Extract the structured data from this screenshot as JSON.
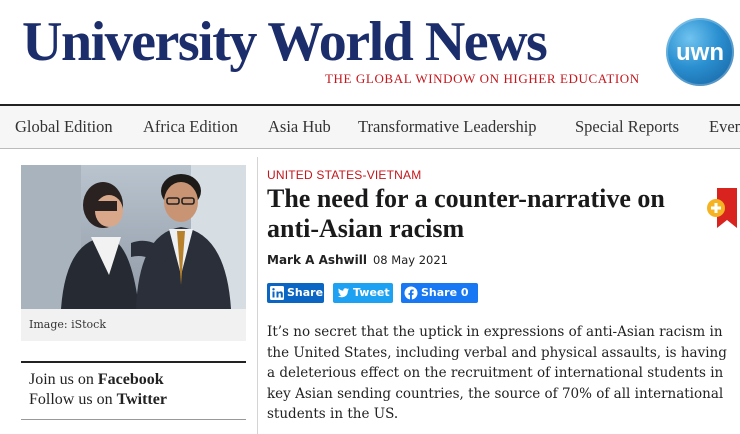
{
  "site": {
    "name": "University World News",
    "tagline": "THE GLOBAL WINDOW ON HIGHER EDUCATION",
    "badge_text": "uwn",
    "brand_color": "#1c2d6b",
    "accent_color": "#c4161c"
  },
  "nav": {
    "items": [
      {
        "label": "Global Edition"
      },
      {
        "label": "Africa Edition"
      },
      {
        "label": "Asia Hub"
      },
      {
        "label": "Transformative Leadership"
      },
      {
        "label": "Special Reports"
      },
      {
        "label": "Even"
      }
    ]
  },
  "sidebar": {
    "photo_caption": "Image: iStock",
    "follow_prefix_1": "Join us on ",
    "follow_link_1": "Facebook",
    "follow_prefix_2": "Follow us on ",
    "follow_link_2": "Twitter"
  },
  "article": {
    "section": "UNITED STATES-VIETNAM",
    "headline": "The need for a counter-narrative on anti-Asian racism",
    "author": "Mark A Ashwill",
    "date": "08 May 2021",
    "share": {
      "linkedin_label": "Share",
      "twitter_label": "Tweet",
      "facebook_label": "Share 0"
    },
    "body": "It’s no secret that the uptick in expressions of anti-Asian racism in the United States, including verbal and physical assaults, is having a deleterious effect on the recruitment of international students in key Asian sending countries, the source of 70% of all international students in the US."
  }
}
